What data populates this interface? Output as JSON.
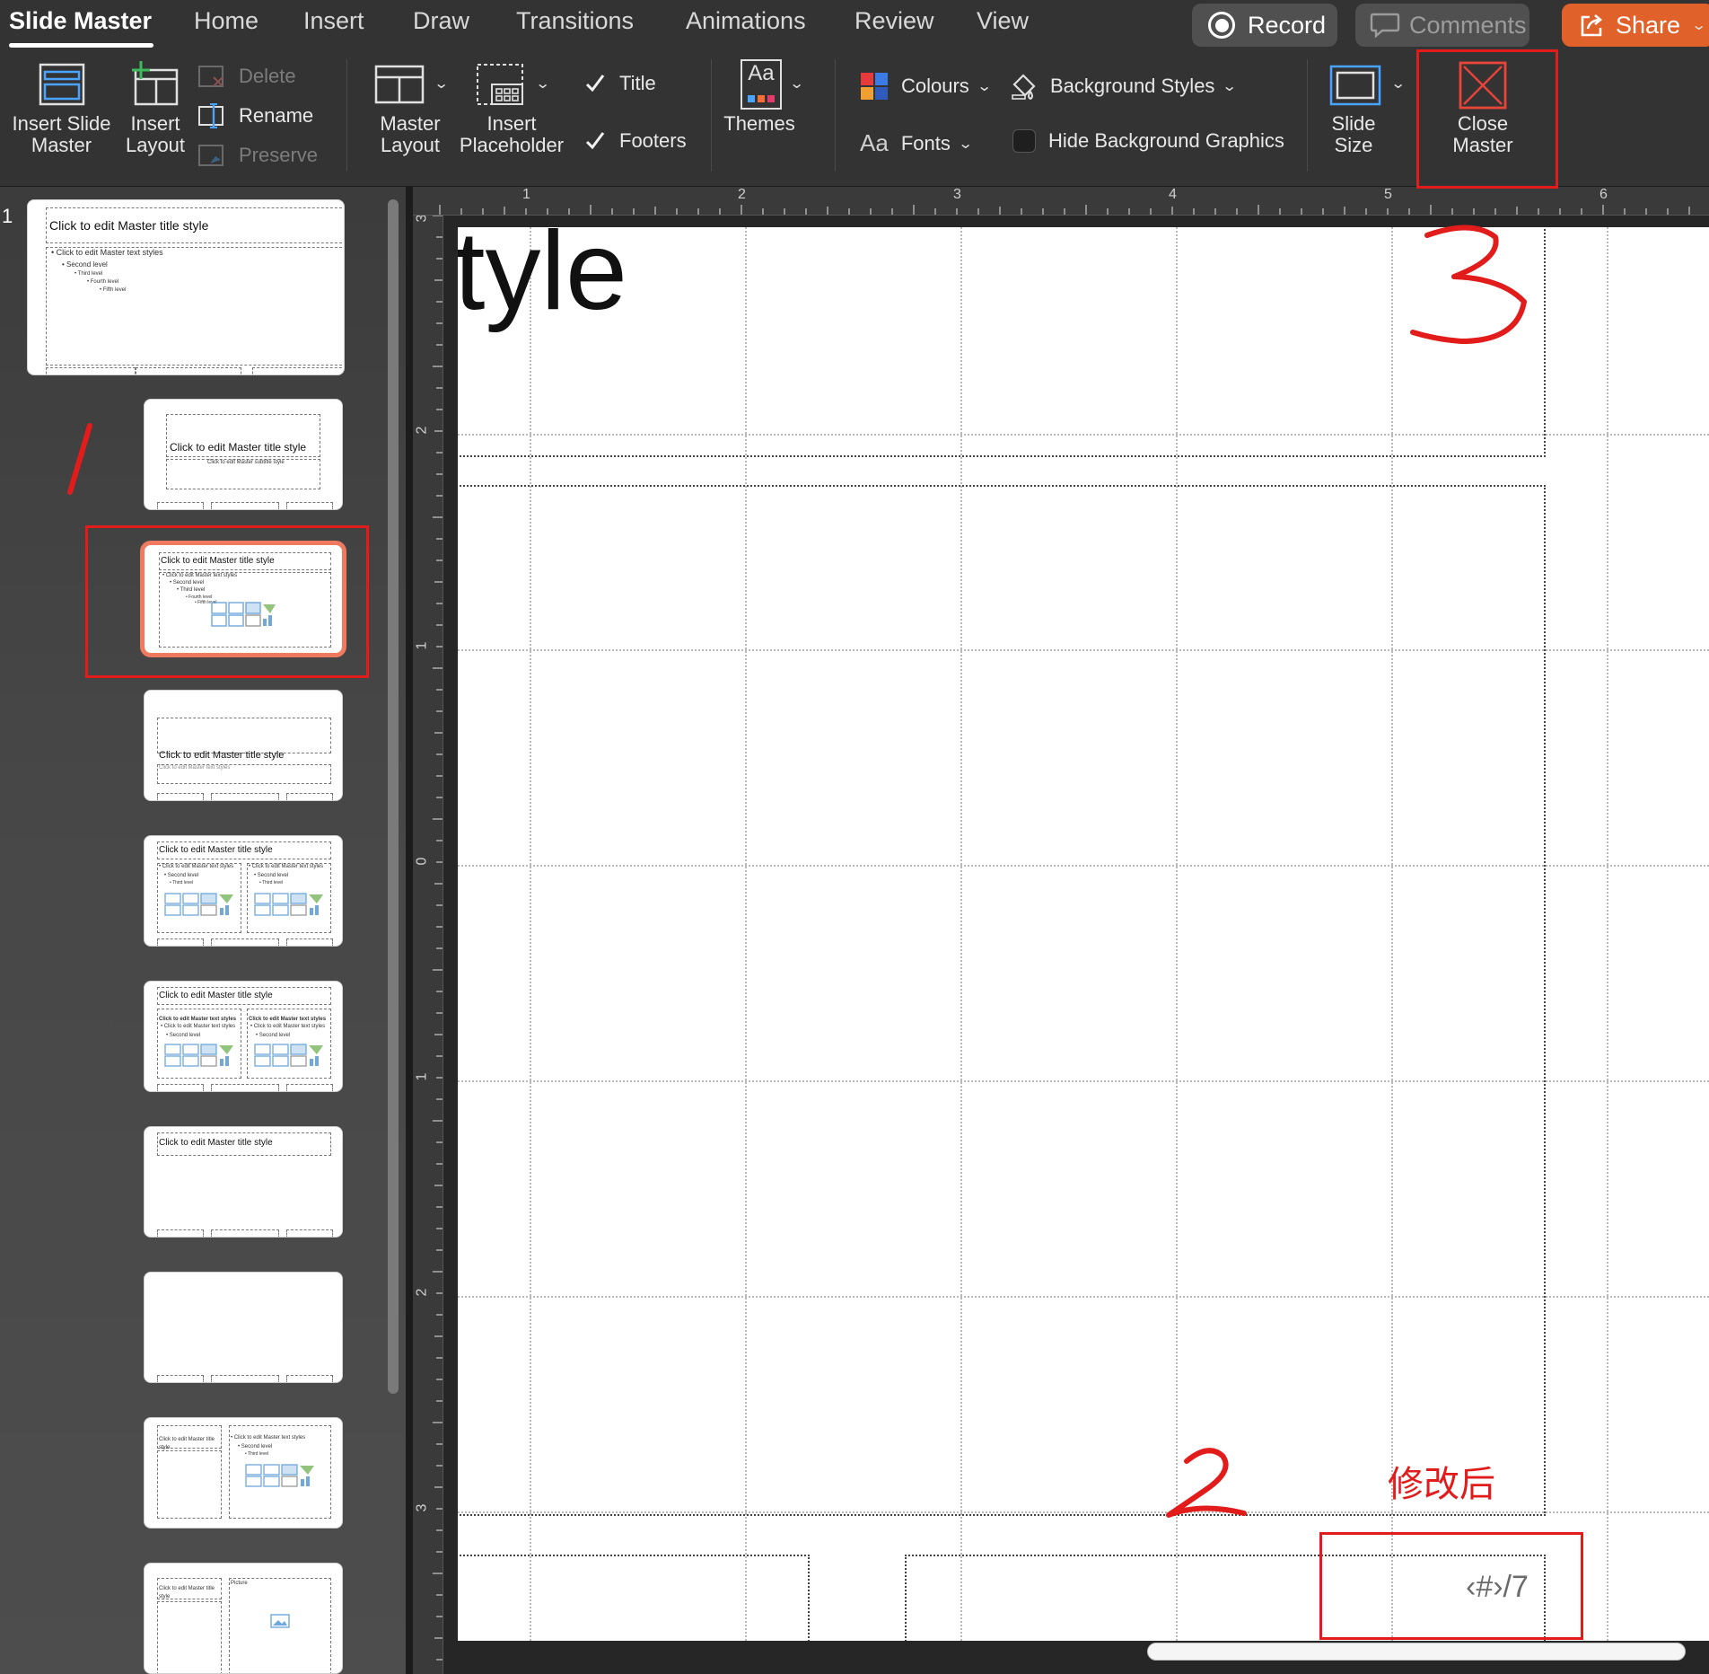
{
  "tabs": [
    {
      "label": "Slide Master",
      "active": true
    },
    {
      "label": "Home"
    },
    {
      "label": "Insert"
    },
    {
      "label": "Draw"
    },
    {
      "label": "Transitions"
    },
    {
      "label": "Animations"
    },
    {
      "label": "Review"
    },
    {
      "label": "View"
    }
  ],
  "top_buttons": {
    "record": "Record",
    "comments": "Comments",
    "share": "Share"
  },
  "ribbon": {
    "insert_slide_master": [
      "Insert Slide",
      "Master"
    ],
    "insert_layout": [
      "Insert",
      "Layout"
    ],
    "delete": "Delete",
    "rename": "Rename",
    "preserve": "Preserve",
    "master_layout": [
      "Master",
      "Layout"
    ],
    "insert_placeholder": [
      "Insert",
      "Placeholder"
    ],
    "title_check": "Title",
    "footers_check": "Footers",
    "themes": "Themes",
    "themes_icon": "Aa",
    "colours": "Colours",
    "fonts": "Fonts",
    "fonts_icon": "Aa",
    "background_styles": "Background Styles",
    "hide_background_graphics": "Hide Background Graphics",
    "slide_size": [
      "Slide",
      "Size"
    ],
    "close_master": [
      "Close",
      "Master"
    ],
    "title_checked": true,
    "footers_checked": true,
    "hide_bg_checked": false
  },
  "slide_panel": {
    "master_number": "1",
    "master_thumb": {
      "title": "Click to edit Master title style",
      "levels": [
        "• Click to edit Master text styles",
        "• Second level",
        "• Third level",
        "• Fourth level",
        "• Fifth level"
      ]
    },
    "layouts": [
      {
        "title": "Click to edit Master title style",
        "subtitle": "Click to edit Master subtitle style"
      },
      {
        "title": "Click to edit Master title style",
        "levels": [
          "• Click to edit Master text styles",
          "• Second level",
          "• Third level",
          "• Fourth level",
          "• Fifth level"
        ],
        "selected": true
      },
      {
        "title": "Click to edit Master title style",
        "subtitle": "Click to edit Master text styles"
      },
      {
        "title": "Click to edit Master title style",
        "col_a": "• Click to edit Master text styles",
        "col_b": "• Click to edit Master text styles",
        "level2": "• Second level",
        "level3": "• Third level"
      },
      {
        "title": "Click to edit Master title style",
        "col_a": "Click to edit Master text styles",
        "col_b": "Click to edit Master text styles",
        "level1": "• Click to edit Master text styles",
        "level2": "• Second level"
      },
      {
        "title": "Click to edit Master title style"
      },
      {},
      {
        "title": "Click to edit Master title style",
        "col_b": "• Click to edit Master text styles",
        "level2": "• Second level",
        "level3": "• Third level"
      },
      {
        "title": "Click to edit Master title style",
        "picture": "Picture"
      }
    ]
  },
  "ruler": {
    "top": [
      "1",
      "2",
      "3",
      "4",
      "5",
      "6"
    ],
    "left": [
      "3",
      "2",
      "1",
      "0",
      "1",
      "2",
      "3"
    ]
  },
  "slide": {
    "title_fragment": "tyle",
    "slide_number_placeholder": "‹#›/7"
  },
  "annotations": {
    "mark1": "1",
    "mark2": "2",
    "mark3": "3",
    "note": "修改后",
    "color": "#e21b1b"
  },
  "colors": {
    "ribbon_bg": "#333333",
    "share": "#e0612a",
    "selection": "#f07a5f",
    "annotation": "#e21b1b"
  }
}
